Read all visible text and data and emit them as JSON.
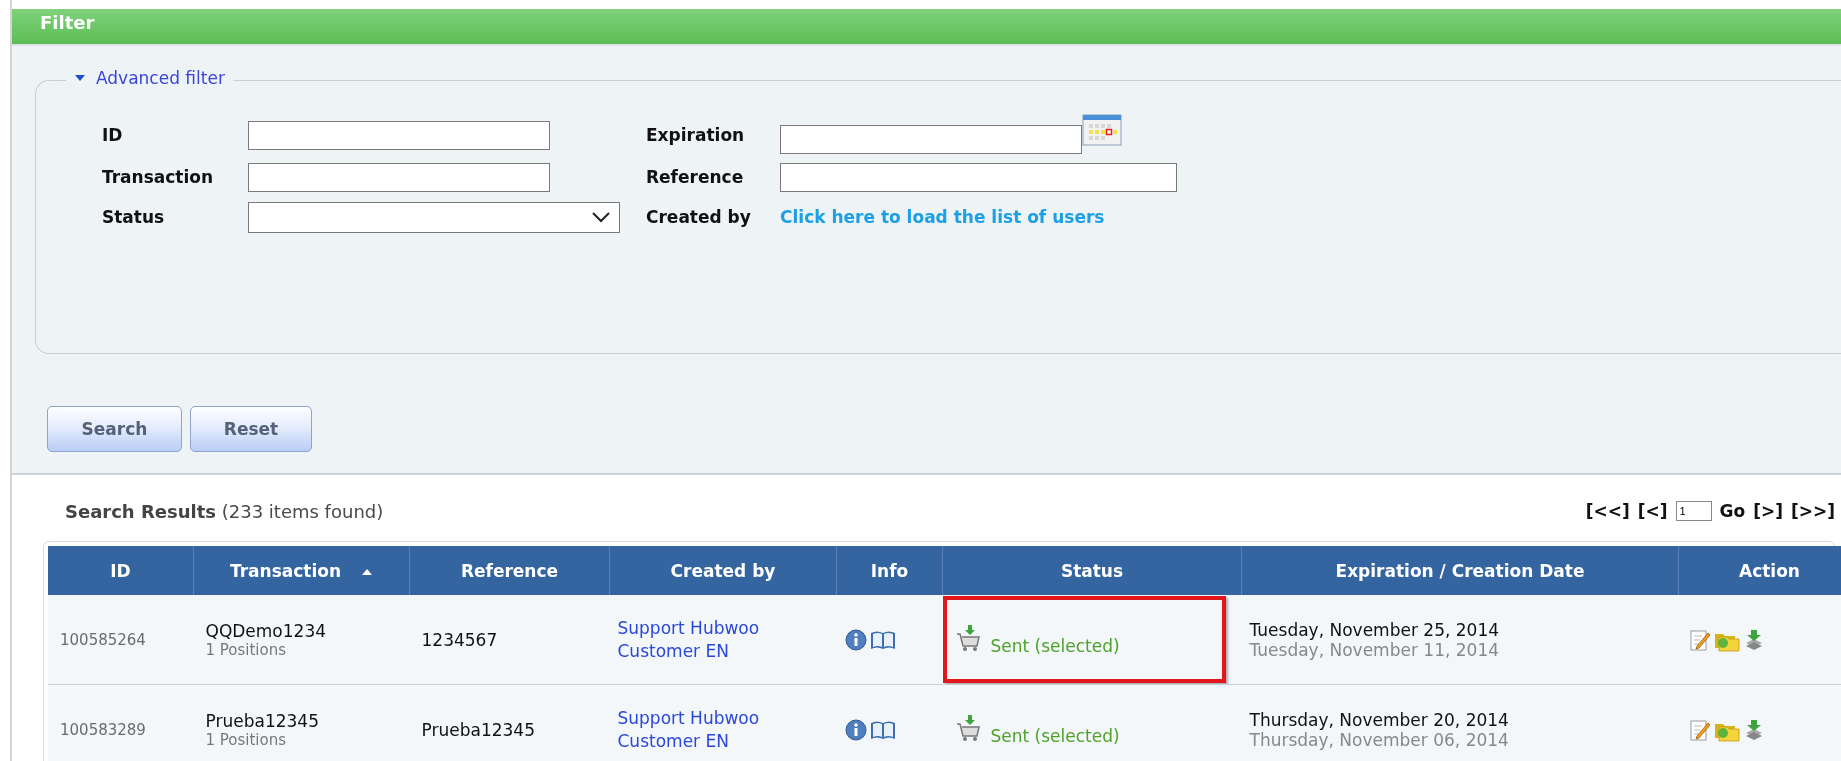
{
  "panel": {
    "title": "Filter"
  },
  "advanced_filter": {
    "label": "Advanced filter",
    "expanded": true
  },
  "fields": [
    {
      "kind": "text",
      "label": "ID"
    },
    {
      "kind": "text",
      "label": "Transaction"
    },
    {
      "kind": "select",
      "label": "Status"
    },
    {
      "kind": "date",
      "label": "Expiration"
    },
    {
      "kind": "text",
      "label": "Reference"
    },
    {
      "kind": "link",
      "label": "Created by",
      "link": "Click here to load the list of users"
    }
  ],
  "buttons": [
    "Search",
    "Reset"
  ],
  "results": {
    "title": "Search Results",
    "count": "(233 items found)"
  },
  "pager": {
    "first": "[<<]",
    "prev": "[<]",
    "page": "1",
    "go": "Go",
    "next": "[>]",
    "last": "[>>]"
  },
  "table": {
    "columns": [
      {
        "label": "ID",
        "sorted": false
      },
      {
        "label": "Transaction",
        "sorted": true
      },
      {
        "label": "Reference",
        "sorted": false
      },
      {
        "label": "Created by",
        "sorted": false
      },
      {
        "label": "Info",
        "sorted": false
      },
      {
        "label": "Status",
        "sorted": false
      },
      {
        "label": "Expiration / Creation Date",
        "sorted": false
      },
      {
        "label": "Action",
        "sorted": false
      }
    ],
    "rows": [
      {
        "id": "100585264",
        "transaction": "QQDemo1234",
        "positions": "1 Positions",
        "reference": "1234567",
        "created_by": "Support Hubwoo Customer EN",
        "status": "Sent (selected)",
        "highlighted": true,
        "expiration": "Tuesday, November 25, 2014",
        "creation": "Tuesday, November 11, 2014"
      },
      {
        "id": "100583289",
        "transaction": "Prueba12345",
        "positions": "1 Positions",
        "reference": "Prueba12345",
        "created_by": "Support Hubwoo Customer EN",
        "status": "Sent (selected)",
        "highlighted": false,
        "expiration": "Thursday, November 20, 2014",
        "creation": "Thursday, November 06, 2014"
      }
    ]
  }
}
